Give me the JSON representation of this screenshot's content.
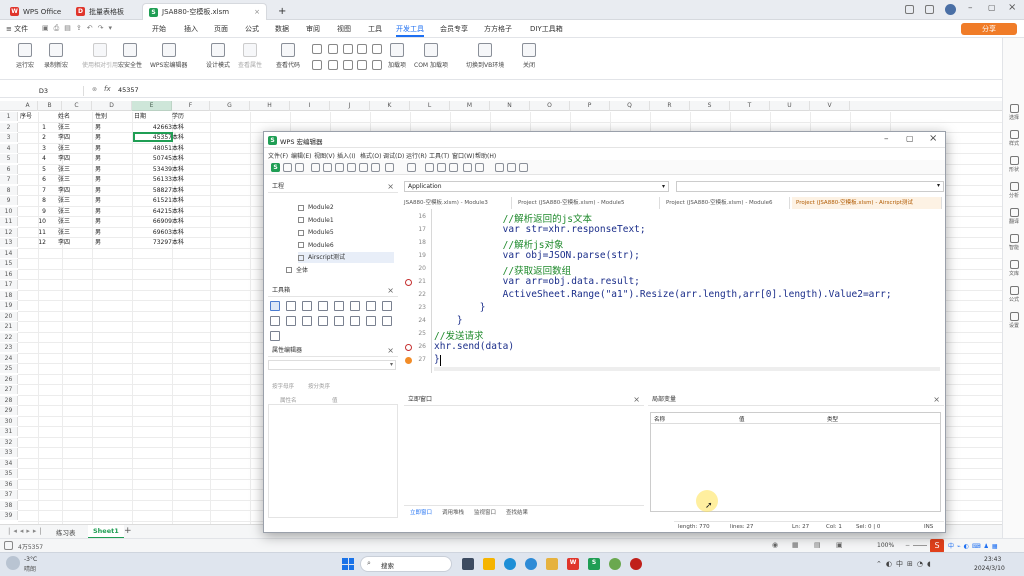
{
  "tabs": {
    "wps_office": "WPS Office",
    "doc2": "批量表格板",
    "active": "JSA880-空模板.xlsm",
    "new_tab": "+"
  },
  "menubar": {
    "file": "≡ 文件",
    "items": [
      "开始",
      "插入",
      "页面",
      "公式",
      "数据",
      "审阅",
      "视图",
      "工具",
      "开发工具",
      "会员专享",
      "方方格子",
      "DIY工具箱"
    ],
    "active_index": 8,
    "share": "分享"
  },
  "ribbon": {
    "buttons": [
      "运行宏",
      "录制新宏",
      "使用相对引用",
      "宏安全性",
      "WPS宏编辑器",
      "设计模式",
      "查看属性",
      "查看代码",
      "加载项",
      "COM 加载项",
      "切换到VB环境",
      "关闭"
    ]
  },
  "formula": {
    "cell_ref": "D3",
    "fx": "fx",
    "value": "45357"
  },
  "sheet": {
    "columns": [
      "A",
      "B",
      "C",
      "D",
      "E",
      "F",
      "G",
      "H",
      "I",
      "J",
      "K",
      "L",
      "M",
      "N",
      "O",
      "P",
      "Q",
      "R",
      "S",
      "T",
      "U",
      "V"
    ],
    "rows": [
      [
        "序号",
        "姓名",
        "性别",
        "日期",
        "学历"
      ],
      [
        "1",
        "张三",
        "男",
        "42663",
        "本科"
      ],
      [
        "2",
        "李四",
        "男",
        "45357",
        "本科"
      ],
      [
        "3",
        "张三",
        "男",
        "48051",
        "本科"
      ],
      [
        "4",
        "李四",
        "男",
        "50745",
        "本科"
      ],
      [
        "5",
        "张三",
        "男",
        "53439",
        "本科"
      ],
      [
        "6",
        "张三",
        "男",
        "56133",
        "本科"
      ],
      [
        "7",
        "李四",
        "男",
        "58827",
        "本科"
      ],
      [
        "8",
        "张三",
        "男",
        "61521",
        "本科"
      ],
      [
        "9",
        "张三",
        "男",
        "64215",
        "本科"
      ],
      [
        "10",
        "张三",
        "男",
        "66909",
        "本科"
      ],
      [
        "11",
        "张三",
        "男",
        "69603",
        "本科"
      ],
      [
        "12",
        "李四",
        "男",
        "73297",
        "本科"
      ]
    ],
    "row_count": 39,
    "sheet_tabs": [
      "练习表",
      "Sheet1"
    ],
    "add_tab": "+"
  },
  "statusbar": {
    "left": "4万5357",
    "zoom": "100%"
  },
  "rightpanel": [
    "选择",
    "样式",
    "形状",
    "分析",
    "翻译",
    "智能",
    "文库",
    "公式",
    "设置"
  ],
  "ide": {
    "title": "WPS 宏编辑器",
    "menu": [
      "文件(F)",
      "编辑(E)",
      "视图(V)",
      "插入(I)",
      "格式(O)",
      "调试(D)",
      "运行(R)",
      "工具(T)",
      "窗口(W)",
      "帮助(H)"
    ],
    "project_pane": "工程",
    "tree": [
      "Module2",
      "Module1",
      "Module5",
      "Module6",
      "Airscript测试",
      "全体"
    ],
    "toolbox_pane": "工具箱",
    "props_pane": "属性编辑器",
    "props_tabs": [
      "按字母序",
      "按分类序"
    ],
    "props_cols": [
      "属性名",
      "值"
    ],
    "combo_left": "Application",
    "doc_tabs": [
      "JSA880-空模板.xlsm) - Module3",
      "Project (JSA880-空模板.xlsm) - Module5",
      "Project (JSA880-空模板.xlsm) - Module6",
      "Project (JSA880-空模板.xlsm) - Airscript测试"
    ],
    "lines": [
      {
        "n": "16",
        "t": "            //解析返回的js文本",
        "c": true
      },
      {
        "n": "17",
        "t": "            var str=xhr.responseText;",
        "c": false
      },
      {
        "n": "18",
        "t": "            //解析js对象",
        "c": true
      },
      {
        "n": "19",
        "t": "            var obj=JSON.parse(str);",
        "c": false
      },
      {
        "n": "20",
        "t": "            //获取返回数组",
        "c": true
      },
      {
        "n": "21",
        "t": "            var arr=obj.data.result;",
        "c": false
      },
      {
        "n": "22",
        "t": "            ActiveSheet.Range(\"a1\").Resize(arr.length,arr[0].length).Value2=arr;",
        "c": false
      },
      {
        "n": "23",
        "t": "        }",
        "c": false
      },
      {
        "n": "24",
        "t": "    }",
        "c": false
      },
      {
        "n": "25",
        "t": "//发送请求",
        "c": true
      },
      {
        "n": "26",
        "t": "xhr.send(data)",
        "c": false
      },
      {
        "n": "27",
        "t": "}",
        "c": false
      }
    ],
    "immediate_pane": "立即窗口",
    "locals_pane": "局部变量",
    "locals_cols": [
      "名称",
      "值",
      "类型"
    ],
    "bottom_tabs": [
      "立即窗口",
      "调用堆栈",
      "监视窗口",
      "查找结果"
    ],
    "status": [
      "length: 770",
      "lines: 27",
      "Ln: 27",
      "Col: 1",
      "Sel: 0 | 0",
      "INS"
    ]
  },
  "taskbar": {
    "weather_temp": "-3°C",
    "weather_text": "晴朗",
    "search": "搜索",
    "time": "23:43",
    "date": "2024/3/10"
  }
}
